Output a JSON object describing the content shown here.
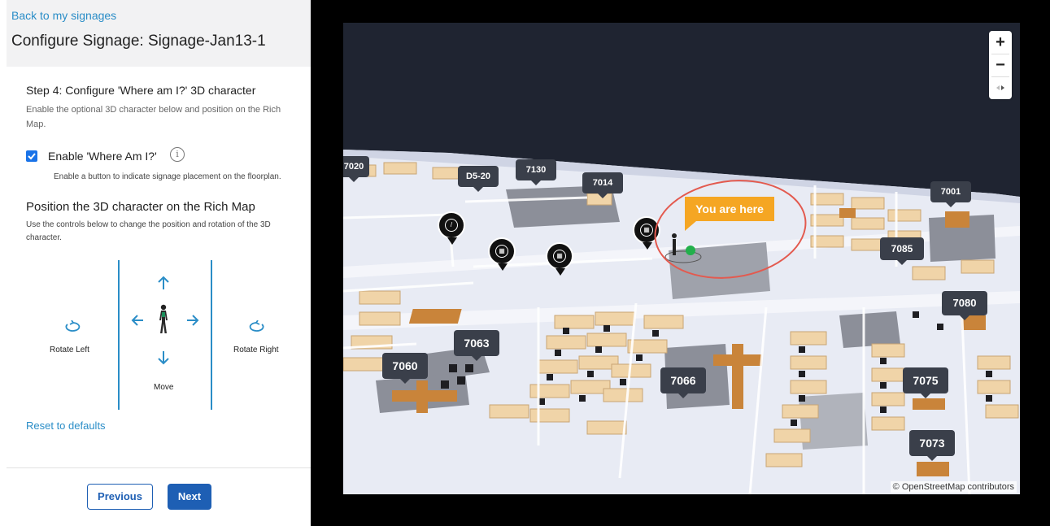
{
  "sidebar": {
    "back_link": "Back to my signages",
    "title": "Configure Signage: Signage-Jan13-1",
    "step_title": "Step 4: Configure 'Where am I?' 3D character",
    "step_desc": "Enable the optional 3D character below and position on the Rich Map.",
    "enable_label": "Enable 'Where Am I?'",
    "enable_checked": true,
    "enable_help": "Enable a button to indicate signage placement on the floorplan.",
    "position_title": "Position the 3D character on the Rich Map",
    "position_desc": "Use the controls below to change the position and rotation of the 3D character.",
    "rotate_left": "Rotate Left",
    "rotate_right": "Rotate Right",
    "move": "Move",
    "reset": "Reset to defaults",
    "previous": "Previous",
    "next": "Next"
  },
  "map": {
    "zoom_in": "+",
    "zoom_out": "−",
    "you_are_here": "You are here",
    "attribution": "© OpenStreetMap contributors",
    "rooms": [
      "7020",
      "D5-20",
      "7130",
      "7014",
      "7001",
      "7085",
      "7080",
      "7063",
      "7060",
      "7066",
      "7075",
      "7073"
    ]
  },
  "colors": {
    "accent": "#1e5fb4",
    "link": "#2a8dc7",
    "marker": "#f5a623",
    "highlight_ring": "#e35a4f"
  }
}
